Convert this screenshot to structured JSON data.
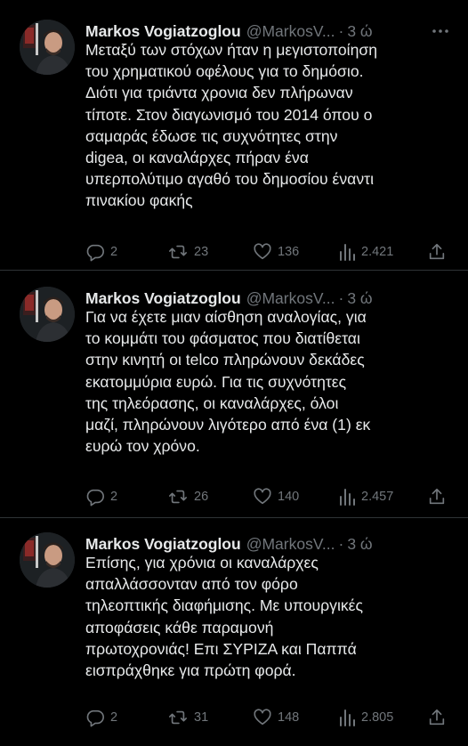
{
  "tweets": [
    {
      "author_name": "Markos Vogiatzoglou",
      "author_handle": "@MarkosV...",
      "separator": "·",
      "time": "3 ώ",
      "text": "Μεταξύ των στόχων ήταν η μεγιστοποίηση\nτου χρηματικού οφέλους για το δημόσιο.\nΔιότι για τριάντα χρονια δεν πλήρωναν\nτίποτε. Στον διαγωνισμό του 2014 όπου ο\nσαμαράς έδωσε τις συχνότητες στην\ndigea, οι καναλάρχες πήραν ένα\nυπερπολύτιμο αγαθό του δημοσίου έναντι\nπινακίου φακής",
      "replies": "2",
      "retweets": "23",
      "likes": "136",
      "views": "2.421"
    },
    {
      "author_name": "Markos Vogiatzoglou",
      "author_handle": "@MarkosV...",
      "separator": "·",
      "time": "3 ώ",
      "text": "Για να έχετε μιαν αίσθηση αναλογίας, για\nτο κομμάτι του φάσματος που διατίθεται\nστην κινητή οι telco πληρώνουν δεκάδες\nεκατομμύρια ευρώ. Για τις συχνότητες\nτης τηλεόρασης, οι  καναλάρχες, όλοι\nμαζί, πληρώνουν λιγότερο από ένα (1) εκ\nευρώ τον χρόνο.",
      "replies": "2",
      "retweets": "26",
      "likes": "140",
      "views": "2.457"
    },
    {
      "author_name": "Markos Vogiatzoglou",
      "author_handle": "@MarkosV...",
      "separator": "·",
      "time": "3 ώ",
      "text": "Επίσης, για χρόνια οι καναλάρχες\nαπαλλάσσονταν από τον φόρο\nτηλεοπτικής διαφήμισης. Με υπουργικές\nαποφάσεις κάθε  παραμονή\nπρωτοχρονιάς! Επι  ΣΥΡΙΖΑ και Παππά\nεισπράχθηκε για πρώτη φορά.",
      "replies": "2",
      "retweets": "31",
      "likes": "148",
      "views": "2.805"
    }
  ],
  "icons": {
    "more": "more-horizontal-icon",
    "reply": "reply-icon",
    "retweet": "retweet-icon",
    "like": "heart-icon",
    "views": "views-chart-icon",
    "share": "share-icon"
  },
  "colors": {
    "background": "#000000",
    "text": "#e7e9ea",
    "secondary": "#71767b",
    "divider": "#2f3336"
  }
}
